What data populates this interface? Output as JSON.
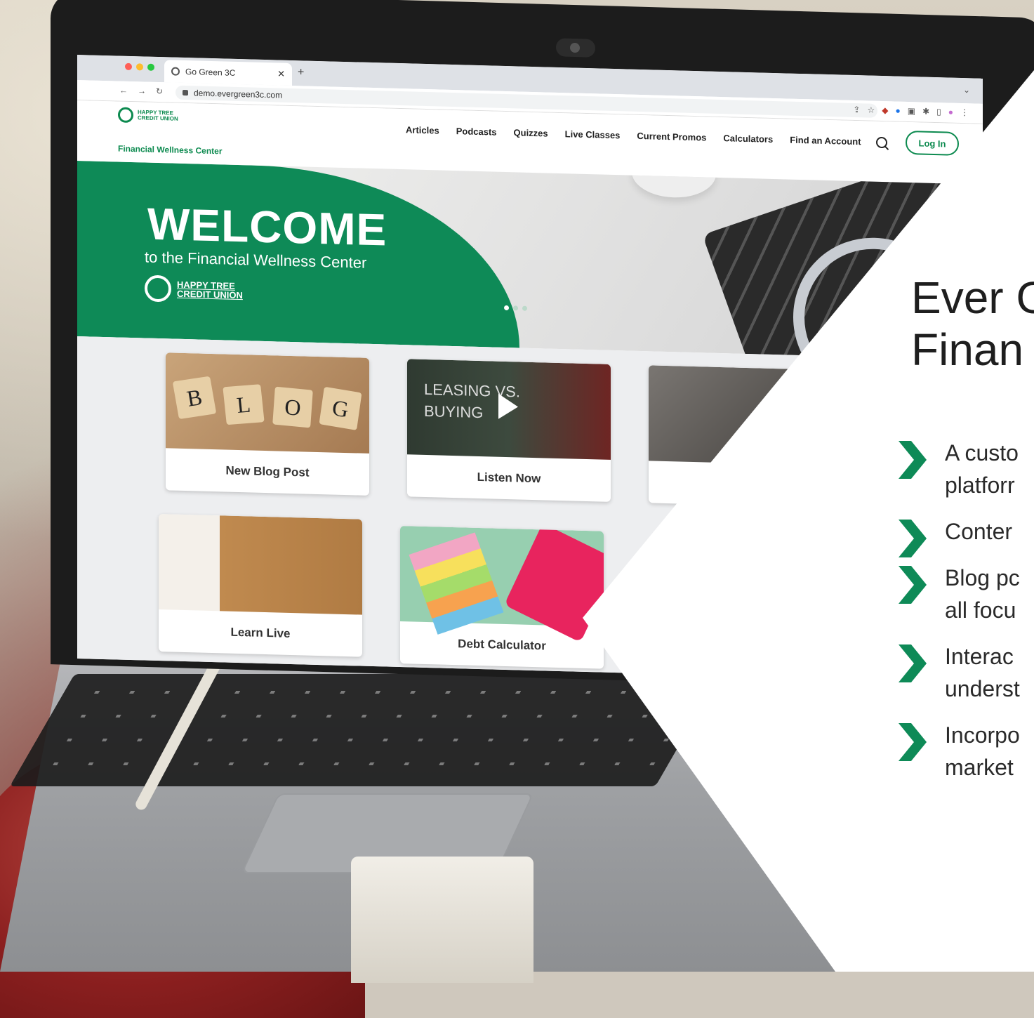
{
  "browser": {
    "tab_title": "Go Green 3C",
    "url": "demo.evergreen3c.com",
    "traffic_colors": [
      "#ff5f57",
      "#febc2e",
      "#28c840"
    ]
  },
  "site": {
    "brand_small": "HAPPY TREE CREDIT UNION",
    "subtitle": "Financial Wellness Center",
    "nav": [
      "Articles",
      "Podcasts",
      "Quizzes",
      "Live Classes",
      "Current Promos",
      "Calculators",
      "Find an Account"
    ],
    "login_label": "Log In",
    "accent_color": "#0e8a57"
  },
  "hero": {
    "title": "WELCOME",
    "subtitle": "to the Financial Wellness Center",
    "logo_text_line1": "HAPPY TREE",
    "logo_text_line2": "CREDIT UNION"
  },
  "cards": [
    {
      "label": "New Blog Post",
      "image": "blog-tiles"
    },
    {
      "label": "Listen Now",
      "image": "leasing-vs-buying-video",
      "image_text_line1": "LEASING VS.",
      "image_text_line2": "BUYING"
    },
    {
      "label": "",
      "image": "person-reading"
    },
    {
      "label": "Learn Live",
      "image": "laptop-typing"
    },
    {
      "label": "Debt Calculator",
      "image": "sticky-notes-calculator"
    }
  ],
  "blog_tiles": [
    "B",
    "L",
    "O",
    "G"
  ],
  "panel": {
    "title_line1": "Ever G",
    "title_line2": "Finan",
    "bullets": [
      "A custo",
      "platforr",
      "Conter",
      "Blog pc",
      "all focu",
      "Interac",
      "underst",
      "Incorpo",
      "market"
    ]
  }
}
